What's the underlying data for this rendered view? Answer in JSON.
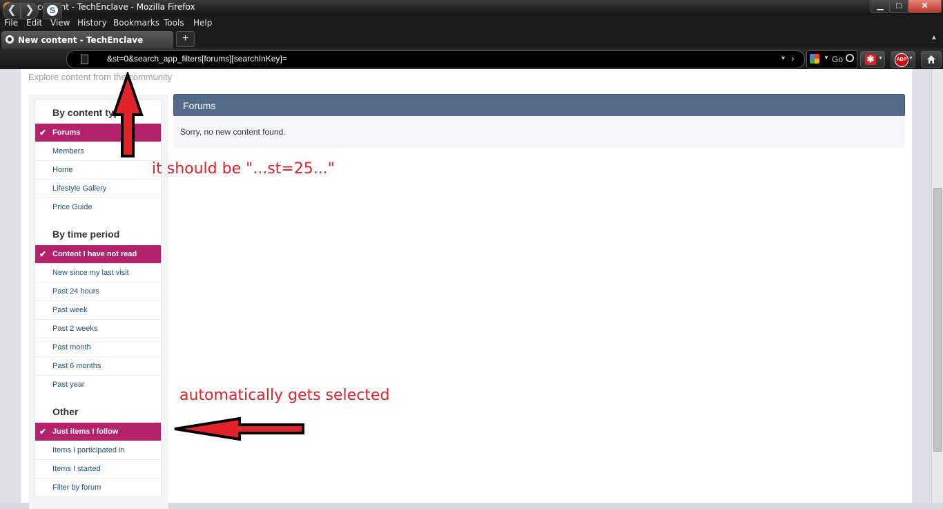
{
  "window": {
    "title": "New content - TechEnclave - Mozilla Firefox",
    "min_glyph": "▁",
    "max_glyph": "□",
    "close_glyph": "✕"
  },
  "menu": [
    "File",
    "Edit",
    "View",
    "History",
    "Bookmarks",
    "Tools",
    "Help"
  ],
  "tab": {
    "title": "New content - TechEnclave",
    "new_tab_glyph": "+",
    "list_glyph": "▲"
  },
  "nav": {
    "back_glyph": "❮",
    "forward_glyph": "❯",
    "s_glyph": "S",
    "url": "&st=0&search_app_filters[forums][searchInKey]=",
    "url_dropdown_glyph": "▼",
    "go_glyph": "›",
    "search_text": "Go",
    "search_dropdown_glyph": "▼",
    "addon_glyph": "✱",
    "abp_text": "ABP",
    "addon_dropdown_glyph": "▼"
  },
  "page": {
    "subtitle": "Explore content from the community",
    "sections": [
      {
        "title": "By content type",
        "items": [
          {
            "label": "Forums",
            "selected": true
          },
          {
            "label": "Members"
          },
          {
            "label": "Home"
          },
          {
            "label": "Lifestyle Gallery"
          },
          {
            "label": "Price Guide"
          }
        ]
      },
      {
        "title": "By time period",
        "items": [
          {
            "label": "Content I have not read",
            "selected": true
          },
          {
            "label": "New since my last visit"
          },
          {
            "label": "Past 24 hours"
          },
          {
            "label": "Past week"
          },
          {
            "label": "Past 2 weeks"
          },
          {
            "label": "Past month"
          },
          {
            "label": "Past 6 months"
          },
          {
            "label": "Past year"
          }
        ]
      },
      {
        "title": "Other",
        "items": [
          {
            "label": "Just items I follow",
            "selected": true
          },
          {
            "label": "Items I participated in"
          },
          {
            "label": "Items I started"
          },
          {
            "label": "Filter by forum"
          }
        ]
      }
    ],
    "results_header": "Forums",
    "results_message": "Sorry, no new content found."
  },
  "annotations": {
    "top": "it should be \"...st=25...\"",
    "bottom": "automatically gets selected",
    "color": "#e0232a"
  }
}
